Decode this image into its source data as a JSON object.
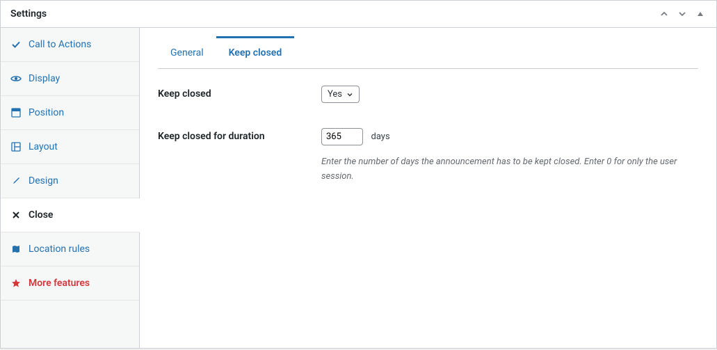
{
  "panel": {
    "title": "Settings"
  },
  "sidebar": {
    "items": [
      {
        "label": "Call to Actions"
      },
      {
        "label": "Display"
      },
      {
        "label": "Position"
      },
      {
        "label": "Layout"
      },
      {
        "label": "Design"
      },
      {
        "label": "Close"
      },
      {
        "label": "Location rules"
      },
      {
        "label": "More features"
      }
    ]
  },
  "tabs": {
    "general": "General",
    "keep_closed": "Keep closed"
  },
  "form": {
    "keep_closed": {
      "label": "Keep closed",
      "value": "Yes"
    },
    "duration": {
      "label": "Keep closed for duration",
      "value": "365",
      "unit": "days",
      "help": "Enter the number of days the announcement has to be kept closed. Enter 0 for only the user session."
    }
  }
}
